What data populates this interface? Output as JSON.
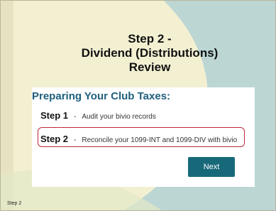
{
  "slide": {
    "title": [
      "Step 2 -",
      "Dividend (Distributions)",
      "Review"
    ],
    "footer": "Step 2"
  },
  "card": {
    "heading": "Preparing Your Club Taxes:",
    "steps": [
      {
        "label": "Step 1",
        "text": "Audit your bivio records"
      },
      {
        "label": "Step 2",
        "text": "Reconcile your 1099-INT and 1099-DIV with bivio"
      }
    ],
    "next_label": "Next",
    "dash": "-"
  },
  "colors": {
    "background": "#f3f0d2",
    "teal_shape": "#bcd6d4",
    "heading": "#1f5f7f",
    "highlight_border": "#c0283a",
    "button": "#17697a"
  }
}
